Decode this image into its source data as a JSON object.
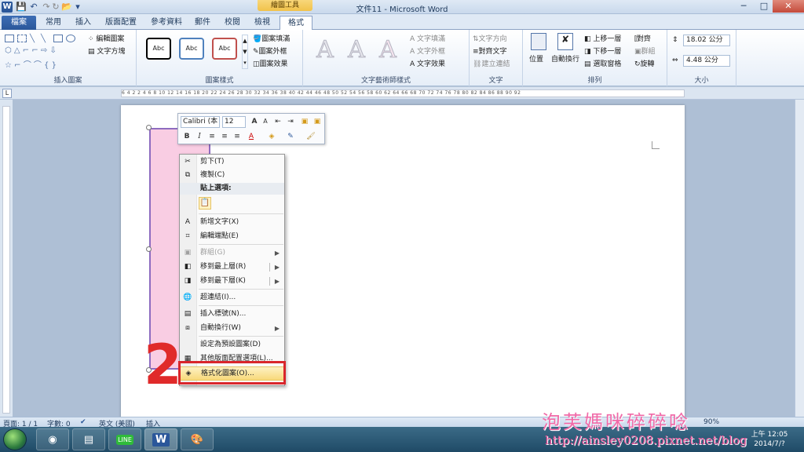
{
  "window": {
    "title": "文件11 - Microsoft Word",
    "contextual_tab_group": "繪圖工具",
    "controls": [
      "─",
      "□",
      "✕"
    ]
  },
  "tabs": [
    {
      "label": "檔案",
      "active": false
    },
    {
      "label": "常用",
      "active": false
    },
    {
      "label": "插入",
      "active": false
    },
    {
      "label": "版面配置",
      "active": false
    },
    {
      "label": "參考資料",
      "active": false
    },
    {
      "label": "郵件",
      "active": false
    },
    {
      "label": "校閱",
      "active": false
    },
    {
      "label": "檢視",
      "active": false
    },
    {
      "label": "格式",
      "active": true
    }
  ],
  "ribbon": {
    "insert_shapes": {
      "label": "插入圖案",
      "edit_shape": "編輯圖案",
      "text_box": "文字方塊"
    },
    "shape_styles": {
      "label": "圖案樣式",
      "sample": "Abc",
      "fill": "圖案填滿",
      "outline": "圖案外框",
      "effects": "圖案效果"
    },
    "wordart_styles": {
      "label": "文字藝術師樣式",
      "sample": "A",
      "text_fill": "文字填滿",
      "text_outline": "文字外框",
      "text_effects": "文字效果"
    },
    "text": {
      "label": "文字",
      "direction": "文字方向",
      "align": "對齊文字",
      "link": "建立連結"
    },
    "arrange": {
      "label": "排列",
      "position": "位置",
      "wrap": "自動換行",
      "bring_forward": "上移一層",
      "send_backward": "下移一層",
      "selection_pane": "選取窗格",
      "align": "對齊",
      "group": "群組",
      "rotate": "旋轉"
    },
    "size": {
      "label": "大小",
      "height": "18.02 公分",
      "width": "4.48 公分"
    }
  },
  "ruler": {
    "marks": [
      "6",
      "4",
      "2",
      "2",
      "4",
      "6",
      "8",
      "10",
      "12",
      "14",
      "16",
      "18",
      "20",
      "22",
      "24",
      "26",
      "28",
      "30",
      "32",
      "34",
      "36",
      "38",
      "40",
      "42",
      "44",
      "46",
      "48",
      "50",
      "52",
      "54",
      "56",
      "58",
      "60",
      "62",
      "64",
      "66",
      "68",
      "70",
      "72",
      "74",
      "76",
      "78",
      "80",
      "82",
      "84",
      "86",
      "88",
      "90",
      "92"
    ]
  },
  "mini_toolbar": {
    "font": "Calibri (本",
    "size": "12",
    "buttons": [
      "A",
      "A",
      "B",
      "I"
    ]
  },
  "context_menu": {
    "items": [
      {
        "label": "剪下(T)",
        "icon": "scissors-icon",
        "glyph": "✂",
        "disabled": false
      },
      {
        "label": "複製(C)",
        "icon": "copy-icon",
        "glyph": "⧉",
        "disabled": false
      },
      {
        "label": "貼上選項:",
        "header": true
      },
      {
        "label": "新增文字(X)",
        "icon": "textbox-icon",
        "glyph": "A",
        "disabled": false
      },
      {
        "label": "編輯端點(E)",
        "icon": "edit-points-icon",
        "glyph": "⌗",
        "disabled": false
      },
      {
        "label": "群組(G)",
        "icon": "group-icon",
        "glyph": "▣",
        "disabled": true,
        "submenu": true
      },
      {
        "label": "移到最上層(R)",
        "icon": "bring-front-icon",
        "glyph": "◧",
        "disabled": false,
        "submenu": true,
        "split": true
      },
      {
        "label": "移到最下層(K)",
        "icon": "send-back-icon",
        "glyph": "◨",
        "disabled": false,
        "submenu": true,
        "split": true
      },
      {
        "label": "超連結(I)...",
        "icon": "hyperlink-icon",
        "glyph": "🌐",
        "disabled": false
      },
      {
        "label": "插入標號(N)...",
        "icon": "caption-icon",
        "glyph": "▤",
        "disabled": false
      },
      {
        "label": "自動換行(W)",
        "icon": "wrap-icon",
        "glyph": "⧈",
        "disabled": false,
        "submenu": true
      },
      {
        "label": "設定為預設圖案(D)",
        "disabled": false
      },
      {
        "label": "其他版面配置選項(L)...",
        "icon": "layout-icon",
        "glyph": "▦",
        "disabled": false
      },
      {
        "label": "格式化圖案(O)...",
        "icon": "format-shape-icon",
        "glyph": "◈",
        "disabled": false,
        "highlight": true
      }
    ]
  },
  "annotation": {
    "step_number": "2"
  },
  "statusbar": {
    "page": "頁面: 1 / 1",
    "words": "字數: 0",
    "language": "英文 (美國)",
    "mode": "插入",
    "zoom": "90%"
  },
  "taskbar": {
    "apps": [
      "chrome",
      "explorer",
      "line",
      "word",
      "paint"
    ],
    "app_glyphs": [
      "◉",
      "▤",
      "LINE",
      "W",
      "🎨"
    ],
    "time": "上午 12:05",
    "date": "2014/7/?"
  },
  "watermark": {
    "title": "泡芙媽咪碎碎唸",
    "url": "http://ainsley0208.pixnet.net/blog"
  }
}
